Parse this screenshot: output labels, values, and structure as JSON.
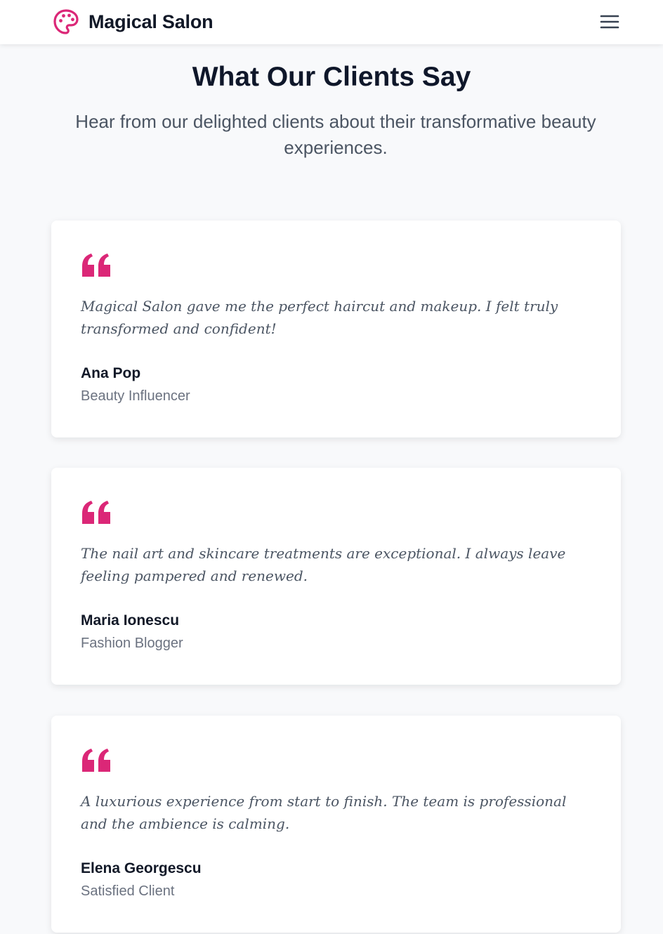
{
  "nav": {
    "brand_name": "Magical Salon",
    "brand_icon": "palette-icon",
    "menu_icon": "hamburger-menu-icon",
    "accent_color": "#db2777"
  },
  "header": {
    "title": "What Our Clients Say",
    "subtitle": "Hear from our delighted clients about their transformative beauty experiences."
  },
  "testimonials": [
    {
      "quote": "Magical Salon gave me the perfect haircut and makeup. I felt truly transformed and confident!",
      "name": "Ana Pop",
      "role": "Beauty Influencer"
    },
    {
      "quote": "The nail art and skincare treatments are exceptional. I always leave feeling pampered and renewed.",
      "name": "Maria Ionescu",
      "role": "Fashion Blogger"
    },
    {
      "quote": "A luxurious experience from start to finish. The team is professional and the ambience is calming.",
      "name": "Elena Georgescu",
      "role": "Satisfied Client"
    }
  ]
}
